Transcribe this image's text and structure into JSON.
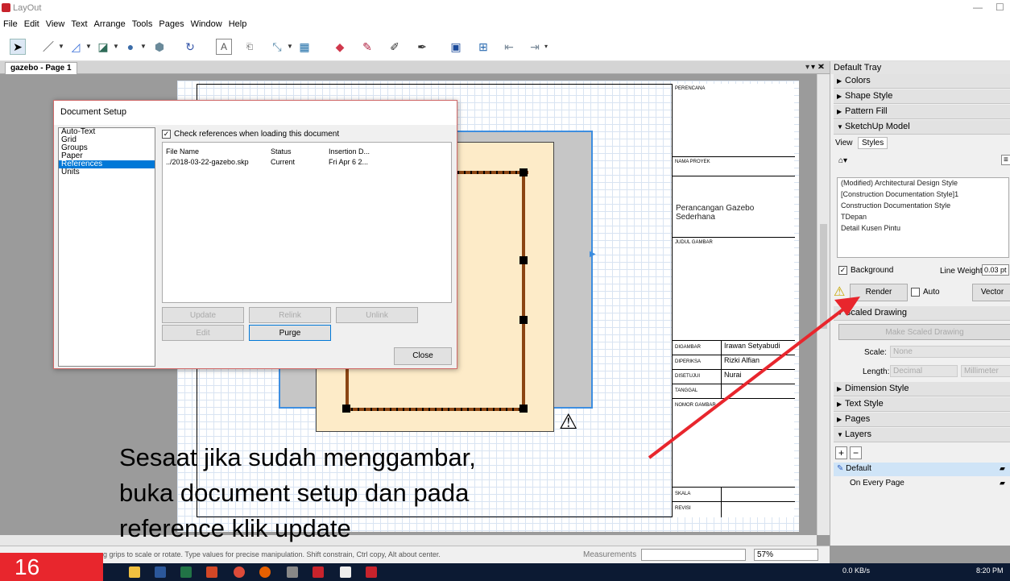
{
  "window": {
    "title": "LayOut",
    "minimize": "—",
    "maximize": "☐"
  },
  "menu": [
    "File",
    "Edit",
    "View",
    "Text",
    "Arrange",
    "Tools",
    "Pages",
    "Window",
    "Help"
  ],
  "toolbar": {
    "icons": [
      "select-tool-icon",
      "line-tool-icon",
      "arc-tool-icon",
      "rectangle-tool-icon",
      "circle-tool-icon",
      "polygon-tool-icon",
      "offset-tool-icon",
      "text-tool-icon",
      "label-tool-icon",
      "dimension-tool-icon",
      "table-tool-icon",
      "eraser-tool-icon",
      "style-tool-icon",
      "split-tool-icon",
      "join-tool-icon",
      "presentation-icon",
      "add-page-icon",
      "previous-page-icon",
      "next-page-icon"
    ]
  },
  "document_tab": {
    "label": "gazebo - Page 1",
    "ctl_dropdown": "▾",
    "ctl_close": "✕"
  },
  "title_block": {
    "perencana": "PERENCANA",
    "nama_proyek": "NAMA PROYEK",
    "project_name": "Perancangan Gazebo Sederhana",
    "judul_gambar": "JUDUL GAMBAR",
    "digambar": "DIGAMBAR",
    "digambar_value": "Irawan Setyabudi",
    "diperiksa": "DIPERIKSA",
    "diperiksa_value": "Rizki Alfian",
    "disetujui": "DISETUJUI",
    "disetujui_value": "Nurai",
    "tanggal": "TANGGAL",
    "nomor_gambar": "NOMOR GAMBAR",
    "skala": "SKALA",
    "revisi": "REVISI"
  },
  "dialog": {
    "title": "Document Setup",
    "categories": [
      "Auto-Text",
      "Grid",
      "Groups",
      "Paper",
      "References",
      "Units"
    ],
    "selected_category": "References",
    "check_refs_label": "Check references when loading this document",
    "check_refs_checked": true,
    "columns": [
      "File Name",
      "Status",
      "Insertion D..."
    ],
    "rows": [
      {
        "file": "../2018-03-22-gazebo.skp",
        "status": "Current",
        "insertion": "Fri Apr  6 2..."
      }
    ],
    "buttons": {
      "update": "Update",
      "relink": "Relink",
      "unlink": "Unlink",
      "edit": "Edit",
      "purge": "Purge",
      "close": "Close"
    }
  },
  "tray": {
    "header": "Default Tray",
    "header_ctl": "▾  ✕",
    "sections": {
      "colors": "Colors",
      "shape_style": "Shape Style",
      "pattern_fill": "Pattern Fill",
      "sketchup_model": "SketchUp Model",
      "scaled_drawing": "Scaled Drawing",
      "dimension_style": "Dimension Style",
      "text_style": "Text Style",
      "pages": "Pages",
      "layers": "Layers"
    },
    "model_tabs": [
      "View",
      "Styles"
    ],
    "styles": [
      "(Modified) Architectural Design Style",
      "[Construction Documentation Style]1",
      "Construction Documentation Style",
      "TDepan",
      "Detail Kusen Pintu"
    ],
    "background_label": "Background",
    "line_weight_label": "Line Weight",
    "line_weight_value": "0.03 pt",
    "render_label": "Render",
    "auto_label": "Auto",
    "vector_label": "Vector",
    "make_scaled_drawing": "Make Scaled Drawing",
    "scale_label": "Scale:",
    "scale_value": "None",
    "length_label": "Length:",
    "length_value": "Decimal",
    "length_unit": "Millimeter",
    "layer_add": "+",
    "layer_remove": "−",
    "layers": [
      "Default",
      "On Every Page"
    ]
  },
  "statusbar": {
    "hint": "g grips to scale or rotate. Type values for precise manipulation. Shift constrain, Ctrl copy, Alt about center.",
    "measurements_label": "Measurements",
    "zoom": "57%"
  },
  "taskbar": {
    "net_speed": "0.0 KB/s",
    "time": "8:20 PM"
  },
  "overlay": {
    "page_number": "16",
    "caption_lines": [
      "Sesaat jika sudah menggambar,",
      "buka document setup dan pada",
      "reference klik update"
    ]
  }
}
